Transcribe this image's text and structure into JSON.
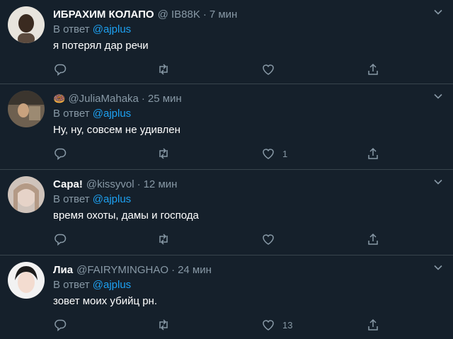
{
  "tweets": [
    {
      "name": "ИБРАХИМ КОЛАПО",
      "emoji": "",
      "handle": "@ IB88K",
      "time": "7 мин",
      "reply_prefix": "В ответ",
      "mention": "@ajplus",
      "text": "я потерял дар речи",
      "likes": ""
    },
    {
      "name": "",
      "emoji": "🍩",
      "handle": "@JuliaMahaka",
      "time": "25 мин",
      "reply_prefix": "В ответ",
      "mention": "@ajplus",
      "text": "Ну, ну, совсем не удивлен",
      "likes": "1"
    },
    {
      "name": "Сара!",
      "emoji": "",
      "handle": "@kissyvol",
      "time": "12 мин",
      "reply_prefix": "В ответ",
      "mention": "@ajplus",
      "text": "время охоты, дамы и господа",
      "likes": ""
    },
    {
      "name": "Лиа",
      "emoji": "",
      "handle": "@FAIRYMINGHAO",
      "time": "24 мин",
      "reply_prefix": "В ответ",
      "mention": "@ajplus",
      "text": "зовет моих убийц рн.",
      "likes": "13"
    }
  ],
  "icons": {
    "reply": "reply-icon",
    "retweet": "retweet-icon",
    "like": "heart-icon",
    "share": "share-icon",
    "more": "chevron-down-icon"
  },
  "colors": {
    "background": "#15202b",
    "muted": "#8899a6",
    "link": "#1da1f2",
    "divider": "#38444d"
  }
}
